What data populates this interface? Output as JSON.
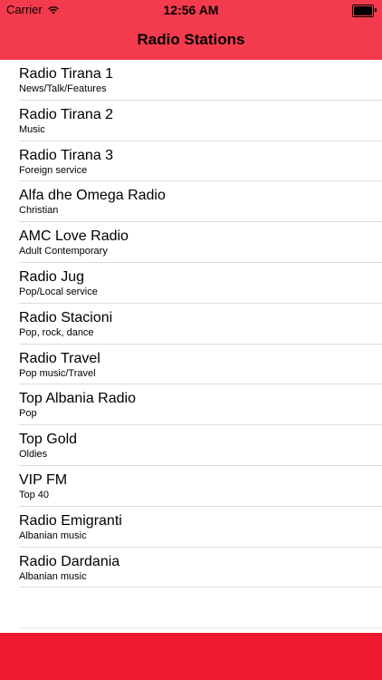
{
  "status_bar": {
    "carrier": "Carrier",
    "time": "12:56 AM",
    "wifi_icon": "wifi-icon",
    "battery_icon": "battery-full-icon"
  },
  "nav": {
    "title": "Radio Stations"
  },
  "colors": {
    "header": "#f33b4d",
    "footer": "#f0192f"
  },
  "stations": [
    {
      "name": "Radio Tirana 1",
      "genre": "News/Talk/Features"
    },
    {
      "name": "Radio Tirana 2",
      "genre": "Music"
    },
    {
      "name": "Radio Tirana 3",
      "genre": "Foreign service"
    },
    {
      "name": "Alfa dhe Omega Radio",
      "genre": "Christian"
    },
    {
      "name": "AMC Love Radio",
      "genre": "Adult Contemporary"
    },
    {
      "name": "Radio Jug",
      "genre": "Pop/Local service"
    },
    {
      "name": "Radio Stacioni",
      "genre": "Pop, rock, dance"
    },
    {
      "name": "Radio Travel",
      "genre": "Pop music/Travel"
    },
    {
      "name": "Top Albania Radio",
      "genre": "Pop"
    },
    {
      "name": "Top Gold",
      "genre": "Oldies"
    },
    {
      "name": "VIP FM",
      "genre": "Top 40"
    },
    {
      "name": "Radio Emigranti",
      "genre": "Albanian music"
    },
    {
      "name": "Radio Dardania",
      "genre": "Albanian music"
    }
  ]
}
